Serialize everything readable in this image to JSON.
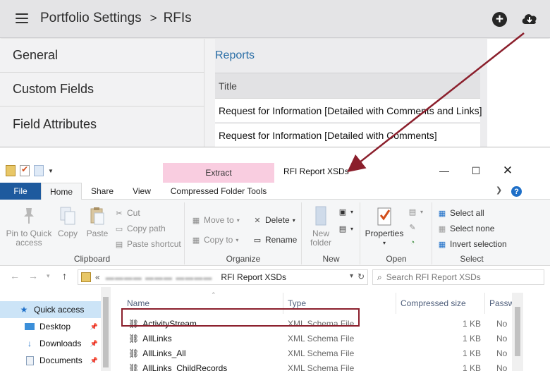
{
  "app": {
    "breadcrumb": {
      "section": "Portfolio Settings",
      "separator": ">",
      "page": "RFIs"
    },
    "icons": {
      "menu": "hamburger-menu-icon",
      "add": "plus-circle-icon",
      "download": "cloud-download-icon"
    }
  },
  "sidebar": {
    "items": [
      {
        "label": "General"
      },
      {
        "label": "Custom Fields"
      },
      {
        "label": "Field Attributes"
      }
    ]
  },
  "reports": {
    "heading": "Reports",
    "column_title": "Title",
    "rows": [
      {
        "title": "Request for Information [Detailed with Comments and Links]"
      },
      {
        "title": "Request for Information [Detailed with Comments]"
      }
    ]
  },
  "explorer": {
    "window_title": "RFI Report XSDs",
    "context_tab": "Extract",
    "context_tab_color": "#f9cde0",
    "tabs": {
      "file": "File",
      "home": "Home",
      "share": "Share",
      "view": "View",
      "tools": "Compressed Folder Tools"
    },
    "ribbon": {
      "clipboard": {
        "label": "Clipboard",
        "pin": "Pin to Quick access",
        "copy": "Copy",
        "paste": "Paste",
        "cut": "Cut",
        "copy_path": "Copy path",
        "paste_shortcut": "Paste shortcut"
      },
      "organize": {
        "label": "Organize",
        "move_to": "Move to",
        "copy_to": "Copy to",
        "delete": "Delete",
        "rename": "Rename"
      },
      "new": {
        "label": "New",
        "new_folder": "New folder"
      },
      "open": {
        "label": "Open",
        "properties": "Properties"
      },
      "select": {
        "label": "Select",
        "select_all": "Select all",
        "select_none": "Select none",
        "invert": "Invert selection"
      }
    },
    "address": {
      "prefix": "«",
      "current": "RFI Report XSDs"
    },
    "search_placeholder": "Search RFI Report XSDs",
    "nav": [
      {
        "label": "Quick access",
        "selected": true
      },
      {
        "label": "Desktop"
      },
      {
        "label": "Downloads"
      },
      {
        "label": "Documents"
      }
    ],
    "columns": {
      "name": "Name",
      "type": "Type",
      "size": "Compressed size",
      "password": "Passw"
    },
    "files": [
      {
        "name": "ActivityStream",
        "type": "XML Schema File",
        "size": "1 KB",
        "password": "No"
      },
      {
        "name": "AllLinks",
        "type": "XML Schema File",
        "size": "1 KB",
        "password": "No"
      },
      {
        "name": "AllLinks_All",
        "type": "XML Schema File",
        "size": "1 KB",
        "password": "No"
      },
      {
        "name": "AllLinks_ChildRecords",
        "type": "XML Schema File",
        "size": "1 KB",
        "password": "No"
      }
    ],
    "annotation_color": "#8b1f2c"
  }
}
